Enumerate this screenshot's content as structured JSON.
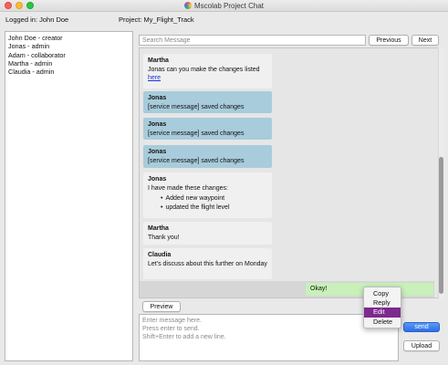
{
  "window": {
    "title": "Mscolab Project Chat"
  },
  "header": {
    "logged_in": "Logged in: John Doe",
    "project": "Project: My_Flight_Track"
  },
  "users": [
    "John Doe - creator",
    "Jonas - admin",
    "Adam - collaborator",
    "Martha - admin",
    "Claudia - admin"
  ],
  "search": {
    "placeholder": "Search Message",
    "value": "",
    "previous_label": "Previous",
    "next_label": "Next"
  },
  "messages": [
    {
      "author": "Martha",
      "text": "Jonas can you make the changes listed",
      "link": "here",
      "kind": "user"
    },
    {
      "author": "Jonas",
      "text": "[service message] saved changes",
      "kind": "service"
    },
    {
      "author": "Jonas",
      "text": "[service message] saved changes",
      "kind": "service"
    },
    {
      "author": "Jonas",
      "text": "[service message] saved changes",
      "kind": "service"
    },
    {
      "author": "Jonas",
      "text": "I have made these changes:",
      "bullets": [
        "Added new waypoint",
        "updated the flight level"
      ],
      "kind": "user"
    },
    {
      "author": "Martha",
      "text": "Thank you!",
      "kind": "user"
    },
    {
      "author": "Claudia",
      "text": "Let's discuss about this further on Monday",
      "kind": "user"
    }
  ],
  "own_message": {
    "text": "Okay!"
  },
  "compose": {
    "preview_label": "Preview",
    "placeholder": "Enter message here.\nPress enter to send.\nShift+Enter to add a new line.",
    "send_label": "send",
    "upload_label": "Upload"
  },
  "context_menu": {
    "items": [
      "Copy",
      "Reply",
      "Edit",
      "Delete"
    ],
    "active_item": "Edit",
    "active_color": "#7d2a8e"
  },
  "colors": {
    "service_message": "#a8ccdb",
    "user_message": "#f0f0f0",
    "own_message": "#c8f0b8",
    "send_button": "#2d6fe6"
  }
}
